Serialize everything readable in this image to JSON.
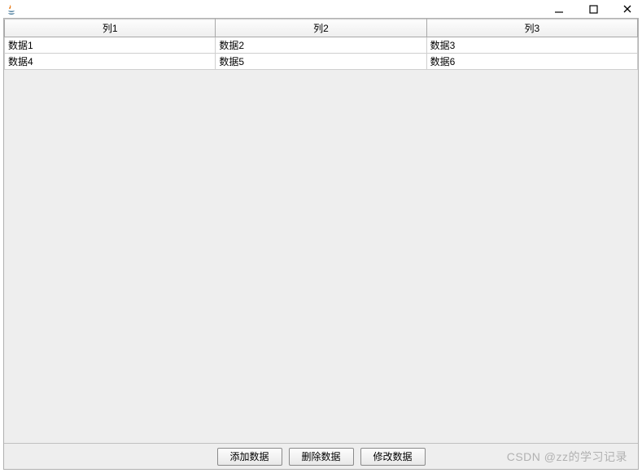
{
  "window": {
    "title": ""
  },
  "table": {
    "headers": [
      "列1",
      "列2",
      "列3"
    ],
    "rows": [
      [
        "数据1",
        "数据2",
        "数据3"
      ],
      [
        "数据4",
        "数据5",
        "数据6"
      ]
    ]
  },
  "buttons": {
    "add": "添加数据",
    "delete": "删除数据",
    "modify": "修改数据"
  },
  "watermark": "CSDN @zz的学习记录"
}
